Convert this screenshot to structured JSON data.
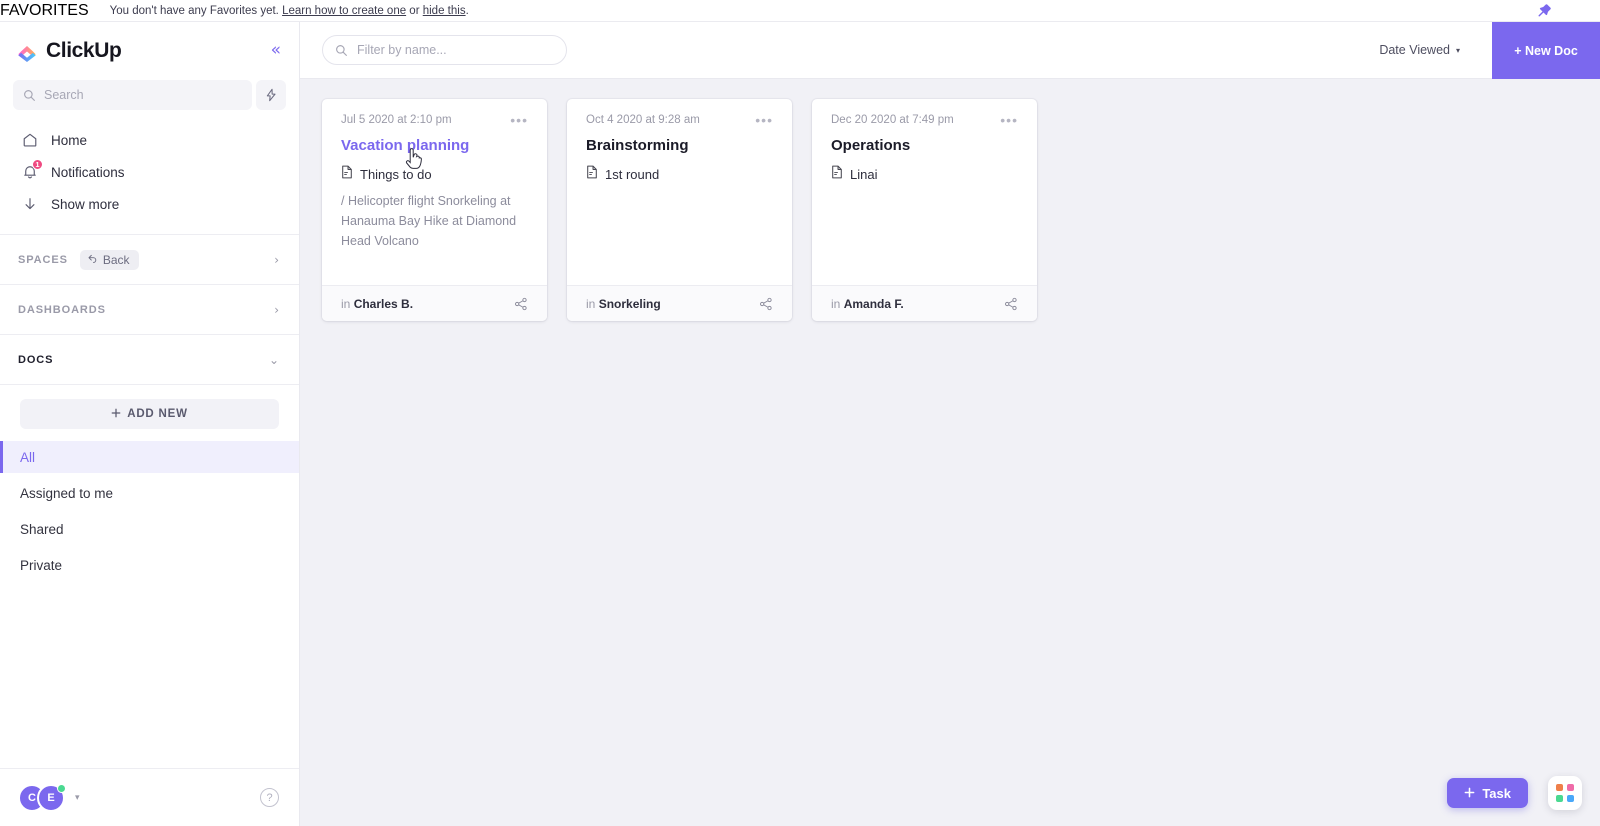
{
  "favorites": {
    "label": "FAVORITES",
    "message_prefix": "You don't have any Favorites yet. ",
    "link_learn": "Learn how to create one",
    "message_or": " or ",
    "link_hide": "hide this",
    "message_suffix": ".",
    "pin_icon": "pin-icon"
  },
  "sidebar": {
    "logo_text": "ClickUp",
    "collapse_icon": "«",
    "search": {
      "placeholder": "Search",
      "icon": "search-icon"
    },
    "bolt_icon": "lightning-bolt-icon",
    "nav": [
      {
        "label": "Home",
        "icon": "home-icon",
        "badge": ""
      },
      {
        "label": "Notifications",
        "icon": "bell-icon",
        "badge": "1"
      },
      {
        "label": "Show more",
        "icon": "arrow-down-icon",
        "badge": ""
      }
    ],
    "sections": [
      {
        "title": "SPACES",
        "chip": "Back",
        "chip_icon": "back-arrow-icon",
        "caret": "›",
        "active": false
      },
      {
        "title": "DASHBOARDS",
        "chip": "",
        "caret": "›",
        "active": false
      },
      {
        "title": "DOCS",
        "chip": "",
        "caret": "⌄",
        "active": true
      }
    ],
    "add_new_label": "ADD NEW",
    "add_new_icon": "plus-icon",
    "doc_filters": [
      {
        "label": "All",
        "selected": true
      },
      {
        "label": "Assigned to me",
        "selected": false
      },
      {
        "label": "Shared",
        "selected": false
      },
      {
        "label": "Private",
        "selected": false
      }
    ],
    "footer": {
      "avatars": [
        "C",
        "E"
      ],
      "caret": "▾",
      "presence": "online",
      "help_icon": "question-mark-icon",
      "help_label": "?"
    }
  },
  "toolbar": {
    "filter_placeholder": "Filter by name...",
    "filter_icon": "search-icon",
    "sort_label": "Date Viewed",
    "sort_caret": "▾",
    "new_doc_label": "+ New Doc"
  },
  "cards": [
    {
      "date": "Jul 5 2020 at 2:10 pm",
      "title": "Vacation planning",
      "title_hovered": true,
      "page": "Things to do",
      "snippet": "/ Helicopter flight Snorkeling at Hanauma Bay Hike at Diamond Head Volcano",
      "location_prefix": "in ",
      "location": "Charles B.",
      "menu_icon": "ellipsis-icon",
      "share_icon": "share-icon",
      "doc_icon": "document-icon"
    },
    {
      "date": "Oct 4 2020 at 9:28 am",
      "title": "Brainstorming",
      "title_hovered": false,
      "page": "1st round",
      "snippet": "",
      "location_prefix": "in ",
      "location": "Snorkeling",
      "menu_icon": "ellipsis-icon",
      "share_icon": "share-icon",
      "doc_icon": "document-icon"
    },
    {
      "date": "Dec 20 2020 at 7:49 pm",
      "title": "Operations",
      "title_hovered": false,
      "page": "Linai",
      "snippet": "",
      "location_prefix": "in ",
      "location": "Amanda F.",
      "menu_icon": "ellipsis-icon",
      "share_icon": "share-icon",
      "doc_icon": "document-icon"
    }
  ],
  "fabs": {
    "task_label": "Task",
    "task_icon": "plus-icon",
    "apps_icon": "app-grid-icon"
  },
  "colors": {
    "accent": "#7b68ee",
    "badge": "#ef4a81",
    "presence": "#4ad991",
    "main_bg": "#f1f1f6",
    "card_footer_bg": "#fafafc"
  }
}
